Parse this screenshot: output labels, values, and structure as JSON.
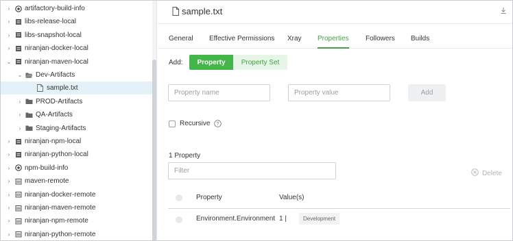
{
  "tree": [
    {
      "label": "artifactory-build-info",
      "icon": "build-info-icon",
      "chevron": "›",
      "selected": false
    },
    {
      "label": "libs-release-local",
      "icon": "local-repo-icon",
      "chevron": "›",
      "selected": false
    },
    {
      "label": "libs-snapshot-local",
      "icon": "local-repo-icon",
      "chevron": "›",
      "selected": false
    },
    {
      "label": "niranjan-docker-local",
      "icon": "local-repo-icon",
      "chevron": "›",
      "selected": false
    },
    {
      "label": "niranjan-maven-local",
      "icon": "local-repo-icon",
      "chevron": "⌄",
      "selected": false
    },
    {
      "label": "Dev-Artifacts",
      "icon": "open-folder-icon",
      "chevron": "⌄",
      "selected": false
    },
    {
      "label": "sample.txt",
      "icon": "file-icon",
      "chevron": "",
      "selected": true
    },
    {
      "label": "PROD-Artifacts",
      "icon": "folder-icon",
      "chevron": "›",
      "selected": false
    },
    {
      "label": "QA-Artifacts",
      "icon": "folder-icon",
      "chevron": "›",
      "selected": false
    },
    {
      "label": "Staging-Artifacts",
      "icon": "folder-icon",
      "chevron": "›",
      "selected": false
    },
    {
      "label": "niranjan-npm-local",
      "icon": "local-repo-icon",
      "chevron": "›",
      "selected": false
    },
    {
      "label": "niranjan-python-local",
      "icon": "local-repo-icon",
      "chevron": "›",
      "selected": false
    },
    {
      "label": "npm-build-info",
      "icon": "build-info-icon",
      "chevron": "›",
      "selected": false
    },
    {
      "label": "maven-remote",
      "icon": "remote-repo-icon",
      "chevron": "›",
      "selected": false
    },
    {
      "label": "niranjan-docker-remote",
      "icon": "remote-repo-icon",
      "chevron": "›",
      "selected": false
    },
    {
      "label": "niranjan-maven-remote",
      "icon": "remote-repo-icon",
      "chevron": "›",
      "selected": false
    },
    {
      "label": "niranjan-npm-remote",
      "icon": "remote-repo-icon",
      "chevron": "›",
      "selected": false
    },
    {
      "label": "niranjan-python-remote",
      "icon": "remote-repo-icon",
      "chevron": "›",
      "selected": false
    }
  ],
  "header": {
    "title": "sample.txt"
  },
  "tabs": [
    "General",
    "Effective Permissions",
    "Xray",
    "Properties",
    "Followers",
    "Builds"
  ],
  "active_tab": "Properties",
  "add": {
    "label": "Add:",
    "property_button": "Property",
    "property_set_button": "Property Set"
  },
  "form": {
    "name_placeholder": "Property name",
    "value_placeholder": "Property value",
    "add_button": "Add",
    "recursive_label": "Recursive"
  },
  "list": {
    "count_label": "1 Property",
    "filter_placeholder": "Filter",
    "delete_label": "Delete"
  },
  "table": {
    "columns": [
      "Property",
      "Value(s)"
    ],
    "rows": [
      {
        "property": "Environment.Environment",
        "count": "1 |",
        "value": "Development"
      }
    ]
  },
  "colors": {
    "accent": "#43b549",
    "accent_light": "#e6f5e6",
    "selected_row": "#e4f1f8"
  }
}
